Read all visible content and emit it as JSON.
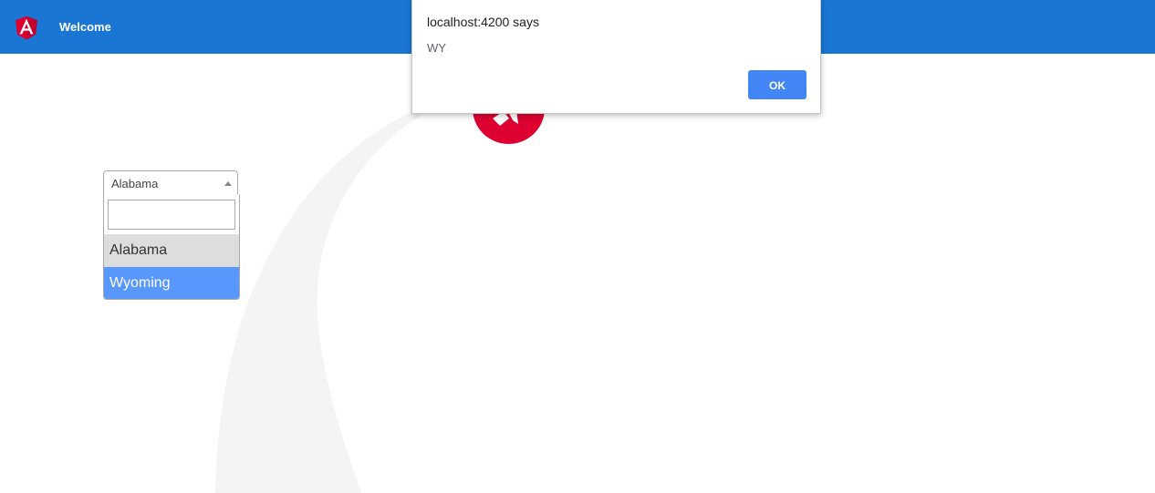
{
  "toolbar": {
    "title": "Welcome",
    "logo_icon": "angular-logo-icon",
    "background_color": "#1976d2"
  },
  "state_select": {
    "selected_value": "Alabama",
    "search_value": "",
    "options": [
      {
        "label": "Alabama",
        "state": "hover"
      },
      {
        "label": "Wyoming",
        "state": "highlighted"
      }
    ],
    "highlight_color": "#5897fb",
    "hover_color": "#dddddd"
  },
  "alert": {
    "title": "localhost:4200 says",
    "message": "WY",
    "ok_label": "OK",
    "button_color": "#4285f4"
  },
  "decorations": {
    "rocket_icon": "rocket-icon",
    "rocket_circle_color": "#dd0031"
  }
}
